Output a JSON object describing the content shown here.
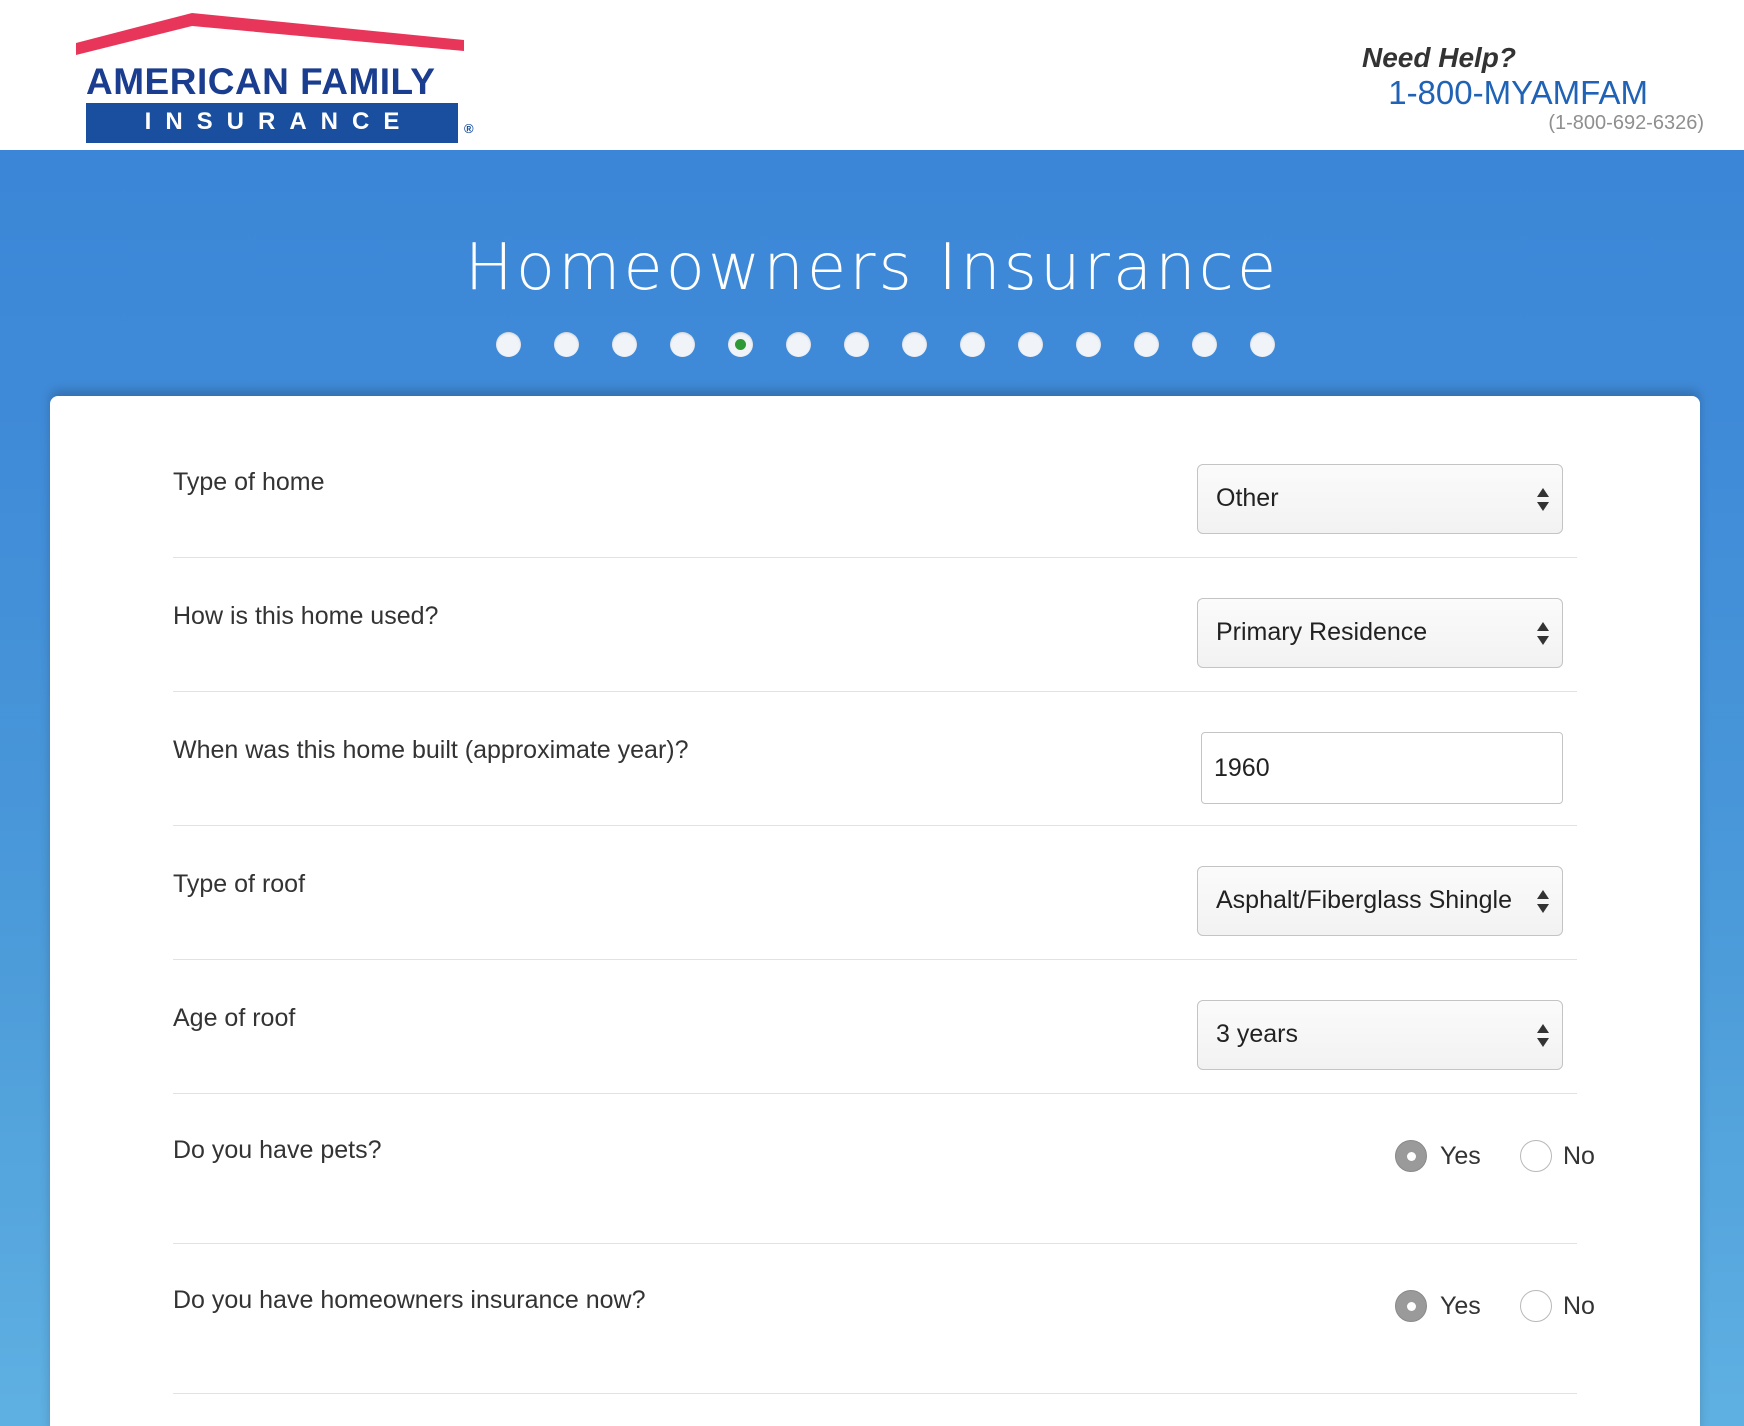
{
  "brand": {
    "name_line1": "AMERICAN FAMILY",
    "name_line2": "INSURANCE",
    "registered": "®",
    "roof_color": "#e8365a",
    "brand_blue": "#1a4fa0"
  },
  "help": {
    "title": "Need Help?",
    "phone": "1-800-MYAMFAM",
    "digits": "(1-800-692-6326)"
  },
  "banner": {
    "title": "Homeowners Insurance",
    "progress": {
      "total_steps": 14,
      "current_step": 5
    }
  },
  "form": {
    "questions": [
      {
        "label": "Type of home",
        "type": "select",
        "value": "Other"
      },
      {
        "label": "How is this home used?",
        "type": "select",
        "value": "Primary Residence"
      },
      {
        "label": "When was this home built (approximate year)?",
        "type": "text",
        "value": "1960"
      },
      {
        "label": "Type of roof",
        "type": "select",
        "value": "Asphalt/Fiberglass Shingle"
      },
      {
        "label": "Age of roof",
        "type": "select",
        "value": "3 years"
      },
      {
        "label": "Do you have pets?",
        "type": "radio",
        "yes": "Yes",
        "no": "No",
        "selected": "Yes"
      },
      {
        "label": "Do you have homeowners insurance now?",
        "type": "radio",
        "yes": "Yes",
        "no": "No",
        "selected": "Yes"
      }
    ]
  },
  "colors": {
    "banner_blue": "#3c86d7",
    "active_step": "#2e9a35",
    "phone_blue": "#1f62b6"
  }
}
